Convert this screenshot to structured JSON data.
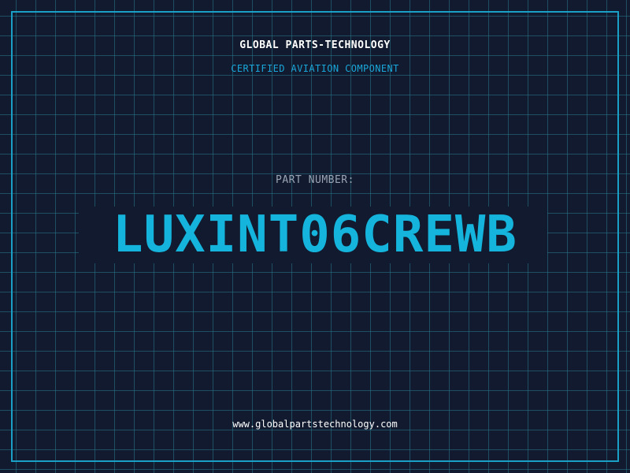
{
  "header": {
    "brand": "GLOBAL PARTS-TECHNOLOGY",
    "tagline": "CERTIFIED AVIATION COMPONENT"
  },
  "part": {
    "label": "PART NUMBER:",
    "number": "LUXINT06CREWB"
  },
  "footer": {
    "url": "www.globalpartstechnology.com"
  },
  "colors": {
    "background": "#111a2e",
    "grid": "#28788c",
    "frame": "#1a9fc6",
    "accent": "#14b4dc",
    "label": "#9aa6b5",
    "text": "#ffffff"
  }
}
